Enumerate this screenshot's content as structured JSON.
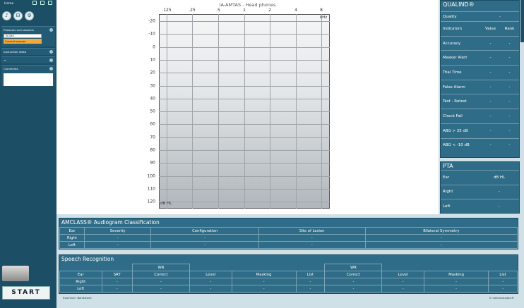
{
  "sidebar": {
    "home_label": "Home",
    "protocols_label": "Protocols and sessions",
    "protocol_value": "AC440",
    "session_value": "Current session",
    "instruction_label": "Instruction Video",
    "comments_label": "Comments",
    "start_label": "START"
  },
  "audiogram": {
    "title": "IA-AMTAS - Head phones",
    "x_ticks": [
      ".125",
      ".25",
      ".5",
      "1",
      "2",
      "4",
      "8"
    ],
    "x_unit": "kHz",
    "y_ticks": [
      "-20",
      "-10",
      "0",
      "10",
      "20",
      "30",
      "40",
      "50",
      "60",
      "70",
      "80",
      "90",
      "100",
      "110",
      "120"
    ],
    "y_unit": "dB HL"
  },
  "qualind": {
    "title": "QUALIND®",
    "quality_label": "Quality",
    "quality_value": "-",
    "headers": [
      "Indicators",
      "Value",
      "Rank"
    ],
    "rows": [
      {
        "label": "Accuracy",
        "value": "-",
        "rank": "-"
      },
      {
        "label": "Masker Alert",
        "value": "-",
        "rank": "-"
      },
      {
        "label": "Trial Time",
        "value": "-",
        "rank": "-"
      },
      {
        "label": "False Alarm",
        "value": "-",
        "rank": "-"
      },
      {
        "label": "Test - Retest",
        "value": "-",
        "rank": "-"
      },
      {
        "label": "Check Fail",
        "value": "-",
        "rank": "-"
      },
      {
        "label": "ABG > 35 dB",
        "value": "-",
        "rank": "-"
      },
      {
        "label": "ABG < -10 dB",
        "value": "-",
        "rank": "-"
      }
    ]
  },
  "pta": {
    "title": "PTA",
    "headers": [
      "Ear",
      "dB HL"
    ],
    "rows": [
      {
        "ear": "Right",
        "value": "-"
      },
      {
        "ear": "Left",
        "value": "-"
      }
    ]
  },
  "amclass": {
    "title": "AMCLASS® Audiogram Classification",
    "headers": [
      "Ear",
      "Severity",
      "Configuration",
      "Site of Lesion",
      "Bilateral Symmetry"
    ],
    "rows": [
      [
        "Right",
        "-",
        "-",
        "-",
        "-"
      ],
      [
        "Left",
        "-",
        "-",
        "-",
        "-"
      ]
    ]
  },
  "speech": {
    "title": "Speech Recognition",
    "group_label": "WR",
    "headers": [
      "Ear",
      "SRT",
      "Correct",
      "Level",
      "Masking",
      "List",
      "Correct",
      "Level",
      "Masking",
      "List"
    ],
    "rows": [
      [
        "Right",
        "-",
        "-",
        "-",
        "-",
        "-",
        "-",
        "-",
        "-",
        "-"
      ],
      [
        "Left",
        "-",
        "-",
        "-",
        "-",
        "-",
        "-",
        "-",
        "-",
        "-"
      ]
    ]
  },
  "footer": {
    "examiner": "Examiner: Bandstone",
    "copyright": "© Interacoustics®"
  }
}
